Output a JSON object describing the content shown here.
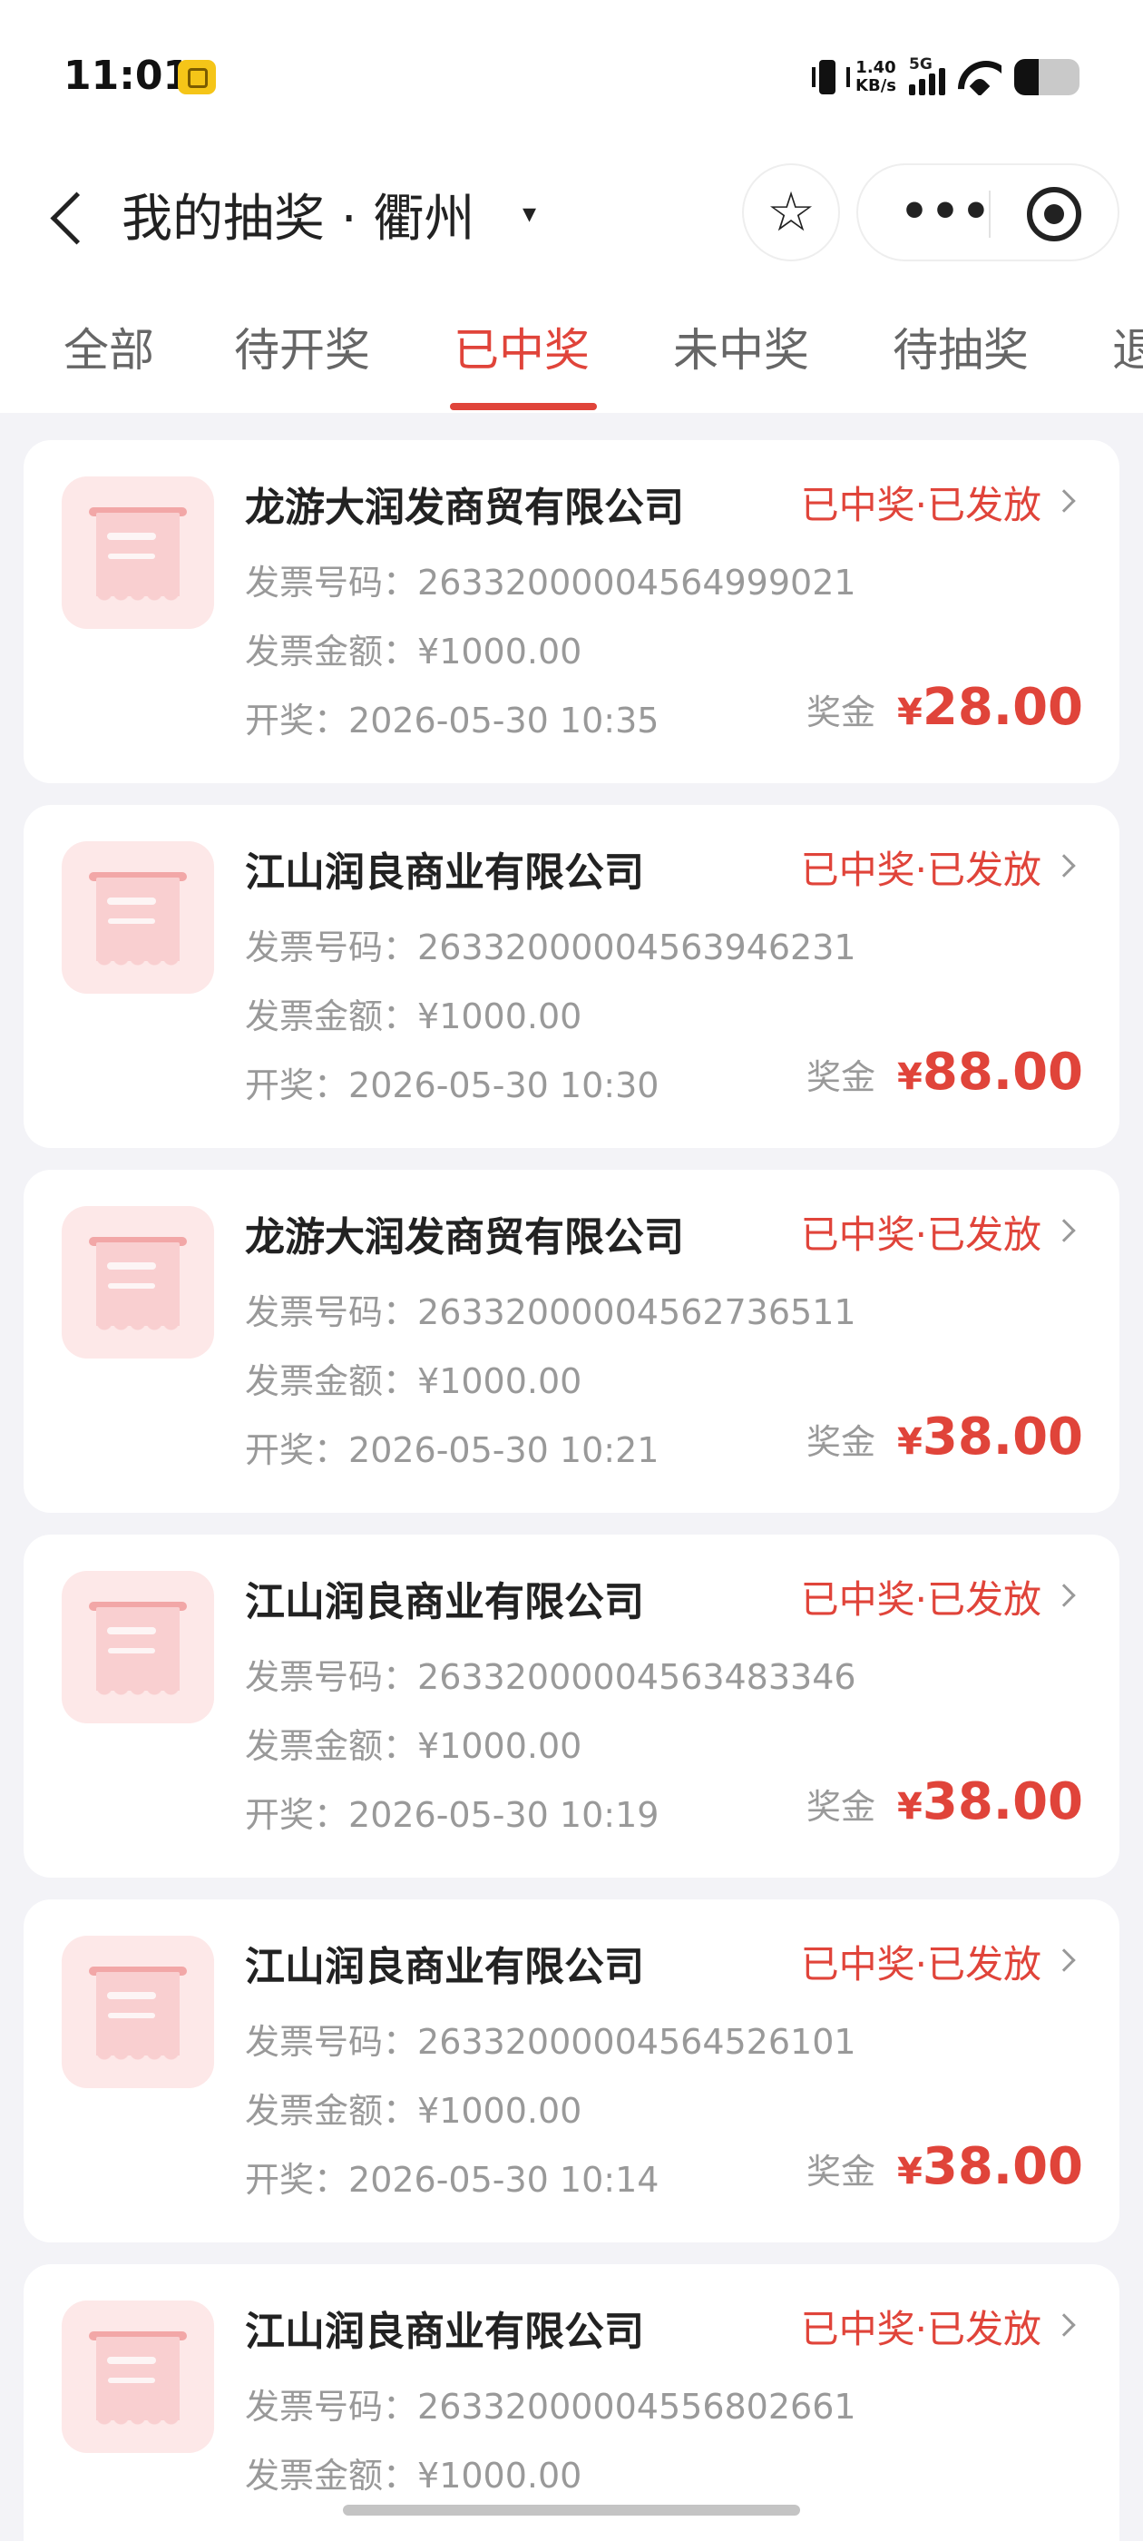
{
  "status_bar": {
    "time": "11:01",
    "net_speed_value": "1.40",
    "net_speed_unit": "KB/s",
    "network": "5G",
    "battery_level": 0.38
  },
  "header": {
    "title": "我的抽奖 · 衢州",
    "caret": "▾",
    "star": "☆",
    "more": "•••"
  },
  "tabs": [
    {
      "label": "全部",
      "active": false
    },
    {
      "label": "待开奖",
      "active": false
    },
    {
      "label": "已中奖",
      "active": true
    },
    {
      "label": "未中奖",
      "active": false
    },
    {
      "label": "待抽奖",
      "active": false
    },
    {
      "label": "退",
      "active": false
    }
  ],
  "labels": {
    "invoice_no": "发票号码：",
    "invoice_amount": "发票金额：",
    "draw_time": "开奖：",
    "prize": "奖金",
    "currency": "¥"
  },
  "colors": {
    "accent": "#e0443a",
    "thumb_bg": "#fde8e8"
  },
  "records": [
    {
      "company": "龙游大润发商贸有限公司",
      "status": "已中奖·已发放",
      "invoice_no": "26332000004564999021",
      "amount": "¥1000.00",
      "draw_time": "2026-05-30 10:35",
      "prize": "28.00"
    },
    {
      "company": "江山润良商业有限公司",
      "status": "已中奖·已发放",
      "invoice_no": "26332000004563946231",
      "amount": "¥1000.00",
      "draw_time": "2026-05-30 10:30",
      "prize": "88.00"
    },
    {
      "company": "龙游大润发商贸有限公司",
      "status": "已中奖·已发放",
      "invoice_no": "26332000004562736511",
      "amount": "¥1000.00",
      "draw_time": "2026-05-30 10:21",
      "prize": "38.00"
    },
    {
      "company": "江山润良商业有限公司",
      "status": "已中奖·已发放",
      "invoice_no": "26332000004563483346",
      "amount": "¥1000.00",
      "draw_time": "2026-05-30 10:19",
      "prize": "38.00"
    },
    {
      "company": "江山润良商业有限公司",
      "status": "已中奖·已发放",
      "invoice_no": "26332000004564526101",
      "amount": "¥1000.00",
      "draw_time": "2026-05-30 10:14",
      "prize": "38.00"
    },
    {
      "company": "江山润良商业有限公司",
      "status": "已中奖·已发放",
      "invoice_no": "26332000004556802661",
      "amount": "¥1000.00",
      "draw_time": "",
      "prize": ""
    }
  ]
}
